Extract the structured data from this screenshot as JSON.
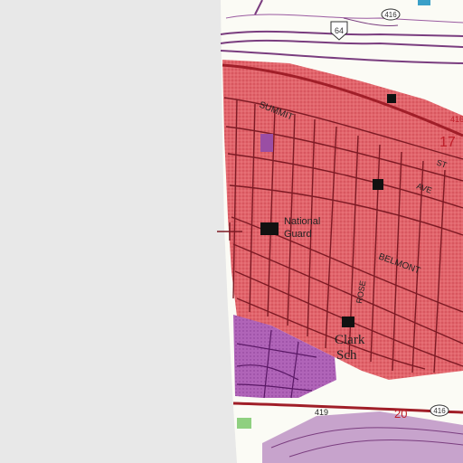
{
  "map": {
    "colors": {
      "margin": "#e8e8e8",
      "paper": "#fbfbf5",
      "urban": "#e2656c",
      "urban_dark": "#cf3e48",
      "street": "#8a1f2a",
      "purple": "#b064b8",
      "purple_line": "#6a1f78",
      "road_red": "#b01f2a",
      "water_blue": "#3aa0c8",
      "green": "#8fd080",
      "building": "#111111"
    },
    "route_badges": [
      {
        "label": "64"
      },
      {
        "label": "416"
      },
      {
        "label": "416"
      },
      {
        "label": "419"
      },
      {
        "label": "20"
      }
    ],
    "labels": {
      "summit": "SUMMIT",
      "national": "National",
      "guard": "Guard",
      "belmont": "BELMONT",
      "rose": "ROSE",
      "ave": "AVE",
      "st": "ST",
      "clark": "Clark",
      "sch": "Sch",
      "num_17": "17",
      "num_416_right": "416"
    }
  }
}
